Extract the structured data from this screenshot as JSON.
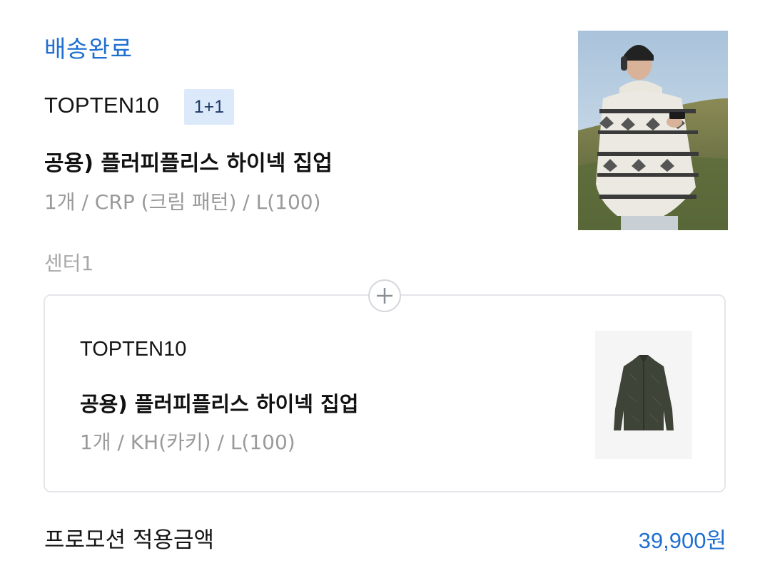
{
  "order": {
    "status": "배송완료",
    "brand": "TOPTEN10",
    "badge": "1+1",
    "product_name": "공용) 플러피플리스 하이넥 집업",
    "options": "1개 / CRP (크림 패턴) / L(100)",
    "center": "센터1",
    "image_icon": "model-photo"
  },
  "bundle": {
    "plus_icon": "plus-icon",
    "brand": "TOPTEN10",
    "product_name": "공용) 플러피플리스 하이넥 집업",
    "options": "1개 / KH(카키) / L(100)",
    "image_icon": "jacket-photo"
  },
  "promotion": {
    "label": "프로모션 적용금액",
    "amount": "39,900원"
  },
  "colors": {
    "accent": "#1f6fd0",
    "badge_bg": "#dbe9fb",
    "muted_text": "#9a9a9a",
    "card_border": "#e4e6ea"
  }
}
